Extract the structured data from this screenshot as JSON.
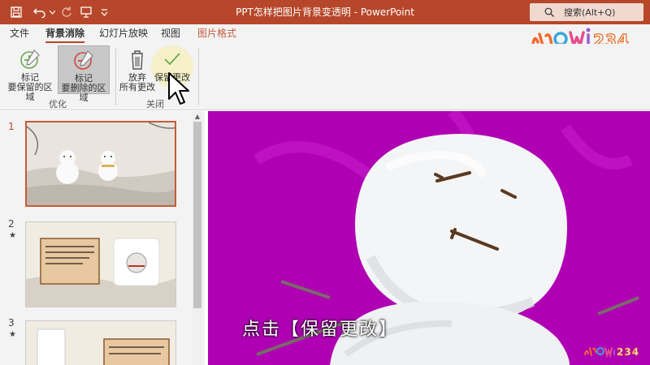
{
  "titlebar": {
    "title": "PPT怎样把图片背景变透明 - PowerPoint",
    "search_placeholder": "搜索(Alt+Q)",
    "accent": "#b7472a"
  },
  "tabs": [
    {
      "label": "文件"
    },
    {
      "label": "背景消除",
      "active": true
    },
    {
      "label": "幻灯片放映"
    },
    {
      "label": "视图"
    },
    {
      "label": "图片格式",
      "contextual": true
    }
  ],
  "brand": {
    "letters": [
      "小",
      "小",
      "W",
      "i",
      "2",
      "3",
      "4"
    ],
    "text": "hiowi234"
  },
  "ribbon": {
    "mark_keep": {
      "line1": "标记",
      "line2": "要保留的区域"
    },
    "mark_remove": {
      "line1": "标记",
      "line2": "要删除的区域"
    },
    "group_optimize": "优化",
    "discard": {
      "line1": "放弃",
      "line2": "所有更改"
    },
    "keep_changes": {
      "label": "保留更改"
    },
    "group_close": "关闭"
  },
  "slides": [
    {
      "number": "1",
      "star": ""
    },
    {
      "number": "2",
      "star": "★"
    },
    {
      "number": "3",
      "star": "★"
    }
  ],
  "subtitle": "点击【保留更改】",
  "watermark": "hiowi234",
  "colors": {
    "magenta_background": "#b400b8",
    "title_bar": "#b7472a"
  }
}
